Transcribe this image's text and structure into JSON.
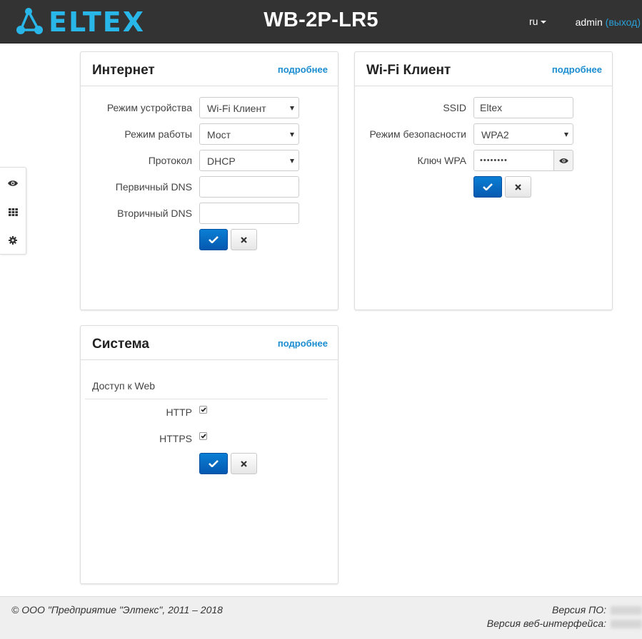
{
  "header": {
    "logo_text": "ELTEX",
    "device_model": "WB-2P-LR5",
    "language": "ru",
    "username": "admin",
    "logout_label": "(выход)"
  },
  "sidenav": {
    "items": [
      {
        "icon": "eye-icon"
      },
      {
        "icon": "grid-icon"
      },
      {
        "icon": "gear-icon"
      }
    ]
  },
  "internet": {
    "title": "Интернет",
    "more_label": "подробнее",
    "device_mode": {
      "label": "Режим устройства",
      "value": "Wi-Fi Клиент"
    },
    "work_mode": {
      "label": "Режим работы",
      "value": "Мост"
    },
    "protocol": {
      "label": "Протокол",
      "value": "DHCP"
    },
    "primary_dns": {
      "label": "Первичный DNS",
      "value": ""
    },
    "secondary_dns": {
      "label": "Вторичный DNS",
      "value": ""
    }
  },
  "wifi_client": {
    "title": "Wi-Fi Клиент",
    "more_label": "подробнее",
    "ssid": {
      "label": "SSID",
      "value": "Eltex"
    },
    "security_mode": {
      "label": "Режим безопасности",
      "value": "WPA2"
    },
    "wpa_key": {
      "label": "Ключ WPA",
      "value": "••••••••"
    }
  },
  "system": {
    "title": "Система",
    "more_label": "подробнее",
    "web_access_label": "Доступ к Web",
    "http": {
      "label": "HTTP",
      "checked": true
    },
    "https": {
      "label": "HTTPS",
      "checked": true
    }
  },
  "footer": {
    "copyright": "© ООО \"Предприятие \"Элтекс\", 2011 – 2018",
    "fw_version_label": "Версия ПО:",
    "web_version_label": "Версия веб-интерфейса:"
  },
  "colors": {
    "topbar": "#333333",
    "accent": "#1a8cd0",
    "logo": "#29b6e8",
    "ok_button": "#0a6cc4"
  }
}
